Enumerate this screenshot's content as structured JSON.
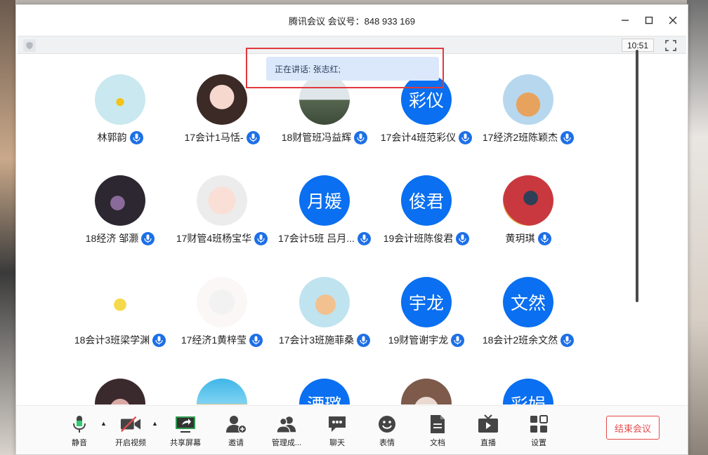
{
  "window": {
    "title": "腾讯会议 会议号：848 933 169",
    "clock": "10:51",
    "speaking": "正在讲话: 张志红;"
  },
  "participants": [
    {
      "name": "林郭韵",
      "avatar_type": "image",
      "avatar_desc": "flower-photo"
    },
    {
      "name": "17会计1马恬-",
      "avatar_type": "image",
      "avatar_desc": "child-photo"
    },
    {
      "name": "18财管班冯益辉",
      "avatar_type": "image",
      "avatar_desc": "mountain-photo"
    },
    {
      "name": "17会计4班范彩仪",
      "avatar_type": "text",
      "avatar_text": "彩仪"
    },
    {
      "name": "17经济2班陈颖杰",
      "avatar_type": "image",
      "avatar_desc": "cat-photo"
    },
    {
      "name": "18经济 邹灏",
      "avatar_type": "image",
      "avatar_desc": "guitar-photo"
    },
    {
      "name": "17财管4班杨宝华",
      "avatar_type": "image",
      "avatar_desc": "baby-photo"
    },
    {
      "name": "17会计5班 吕月...",
      "avatar_type": "text",
      "avatar_text": "月媛"
    },
    {
      "name": "19会计班陈俊君",
      "avatar_type": "text",
      "avatar_text": "俊君"
    },
    {
      "name": "黄玥琪",
      "avatar_type": "image",
      "avatar_desc": "art-photo"
    },
    {
      "name": "18会计3班梁学渊",
      "avatar_type": "image",
      "avatar_desc": "cartoon-sticker"
    },
    {
      "name": "17经济1黄梓莹",
      "avatar_type": "image",
      "avatar_desc": "cartoon-girl"
    },
    {
      "name": "17会计3班施菲桑",
      "avatar_type": "image",
      "avatar_desc": "cartoon-kid"
    },
    {
      "name": "19财管谢宇龙",
      "avatar_type": "text",
      "avatar_text": "宇龙"
    },
    {
      "name": "18会计2班余文然",
      "avatar_type": "text",
      "avatar_text": "文然"
    },
    {
      "name": "",
      "avatar_type": "image",
      "avatar_desc": "girl-photo"
    },
    {
      "name": "",
      "avatar_type": "image",
      "avatar_desc": "pool-photo"
    },
    {
      "name": "",
      "avatar_type": "text",
      "avatar_text": "湮璐"
    },
    {
      "name": "",
      "avatar_type": "image",
      "avatar_desc": "room-photo"
    },
    {
      "name": "",
      "avatar_type": "text",
      "avatar_text": "彩娟"
    }
  ],
  "toolbar": {
    "mute": "静音",
    "video": "开启视频",
    "share": "共享屏幕",
    "invite": "邀请",
    "manage": "管理成...",
    "chat": "聊天",
    "emoji": "表情",
    "docs": "文档",
    "live": "直播",
    "settings": "设置",
    "end": "结束会议"
  },
  "colors": {
    "accent": "#0a6ff0",
    "mic": "#1d6fe6",
    "end_red": "#e54b4b",
    "highlight": "#e0393e",
    "toast_bg": "#dbe8fb"
  }
}
